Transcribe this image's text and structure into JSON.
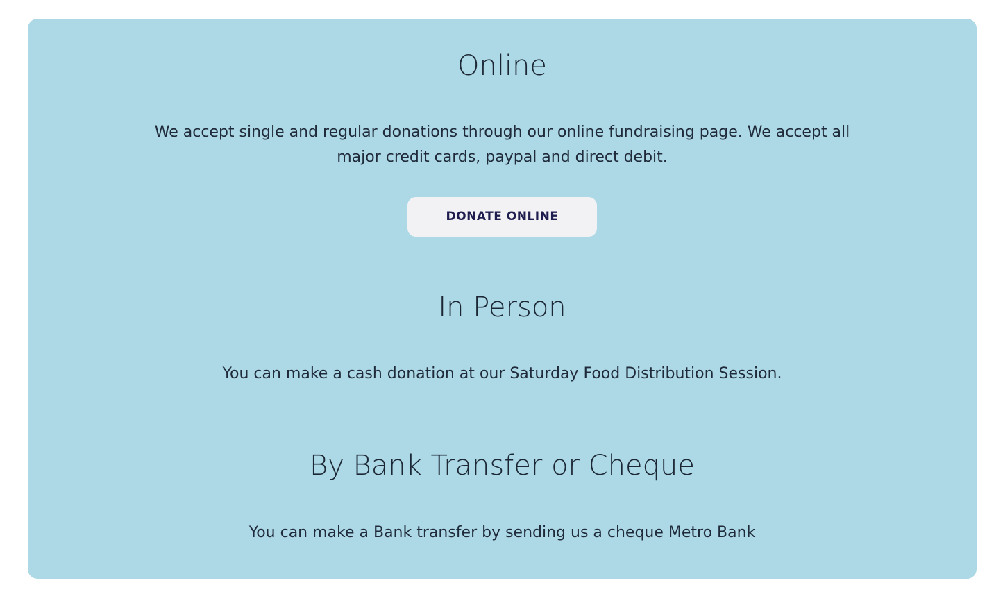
{
  "online": {
    "heading": "Online",
    "body": "We accept single and regular donations through our online fundraising page. We accept all major credit cards, paypal and direct debit.",
    "button_label": "DONATE ONLINE"
  },
  "in_person": {
    "heading": "In Person",
    "body": "You can make a cash donation at our Saturday Food Distribution Session."
  },
  "bank": {
    "heading": "By Bank Transfer or Cheque",
    "body": "You can make a Bank transfer by sending us a cheque Metro Bank"
  },
  "colors": {
    "panel_background": "#add8e6",
    "button_background": "#f2f2f5",
    "button_text": "#1f1d4d",
    "text": "#1f2a3a"
  }
}
